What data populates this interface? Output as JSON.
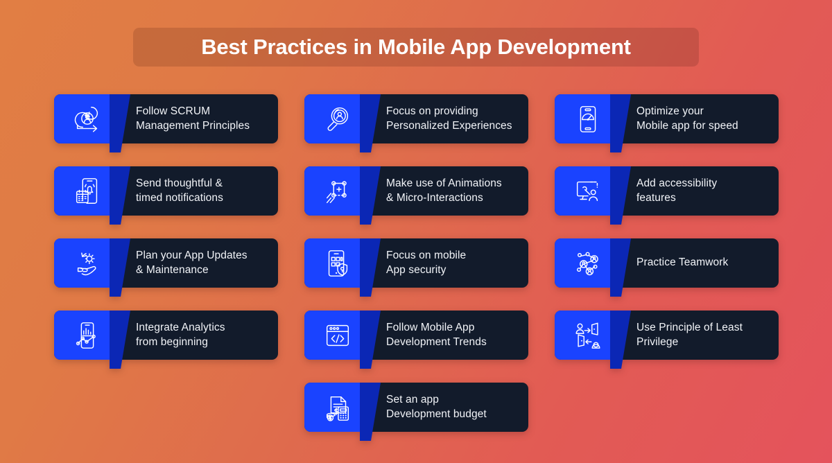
{
  "title": "Best Practices in Mobile App Development",
  "colors": {
    "background_start": "#E17E44",
    "background_end": "#E4535C",
    "card_body": "#121B2B",
    "card_icon_panel": "#1A43FF",
    "card_fold": "#0B27B5",
    "text": "#F2F4F8",
    "title_text": "#FFFFFF"
  },
  "cards": [
    {
      "icon": "scrum-cycle-icon",
      "line1": "Follow SCRUM",
      "line2": "Management Principles"
    },
    {
      "icon": "magnifier-person-icon",
      "line1": "Focus on providing",
      "line2": "Personalized Experiences"
    },
    {
      "icon": "phone-speedometer-icon",
      "line1": "Optimize your",
      "line2": "Mobile app for speed"
    },
    {
      "icon": "phone-bell-calendar-icon",
      "line1": "Send thoughtful &",
      "line2": "timed notifications"
    },
    {
      "icon": "animation-keyframe-icon",
      "line1": "Make use of Animations",
      "line2": "& Micro-Interactions"
    },
    {
      "icon": "monitor-accessibility-icon",
      "line1": "Add accessibility",
      "line2": "features"
    },
    {
      "icon": "hand-gear-icon",
      "line1": "Plan your App Updates",
      "line2": "& Maintenance"
    },
    {
      "icon": "phone-shield-lock-icon",
      "line1": "Focus on mobile",
      "line2": "App security"
    },
    {
      "icon": "team-network-icon",
      "line1": "Practice Teamwork",
      "line2": ""
    },
    {
      "icon": "phone-analytics-icon",
      "line1": "Integrate Analytics",
      "line2": "from beginning"
    },
    {
      "icon": "code-window-icon",
      "line1": "Follow Mobile App",
      "line2": "Development Trends"
    },
    {
      "icon": "least-privilege-icon",
      "line1": "Use Principle of Least",
      "line2": "Privilege"
    },
    {
      "icon": "budget-calculator-icon",
      "line1": "Set an app",
      "line2": "Development budget"
    }
  ]
}
